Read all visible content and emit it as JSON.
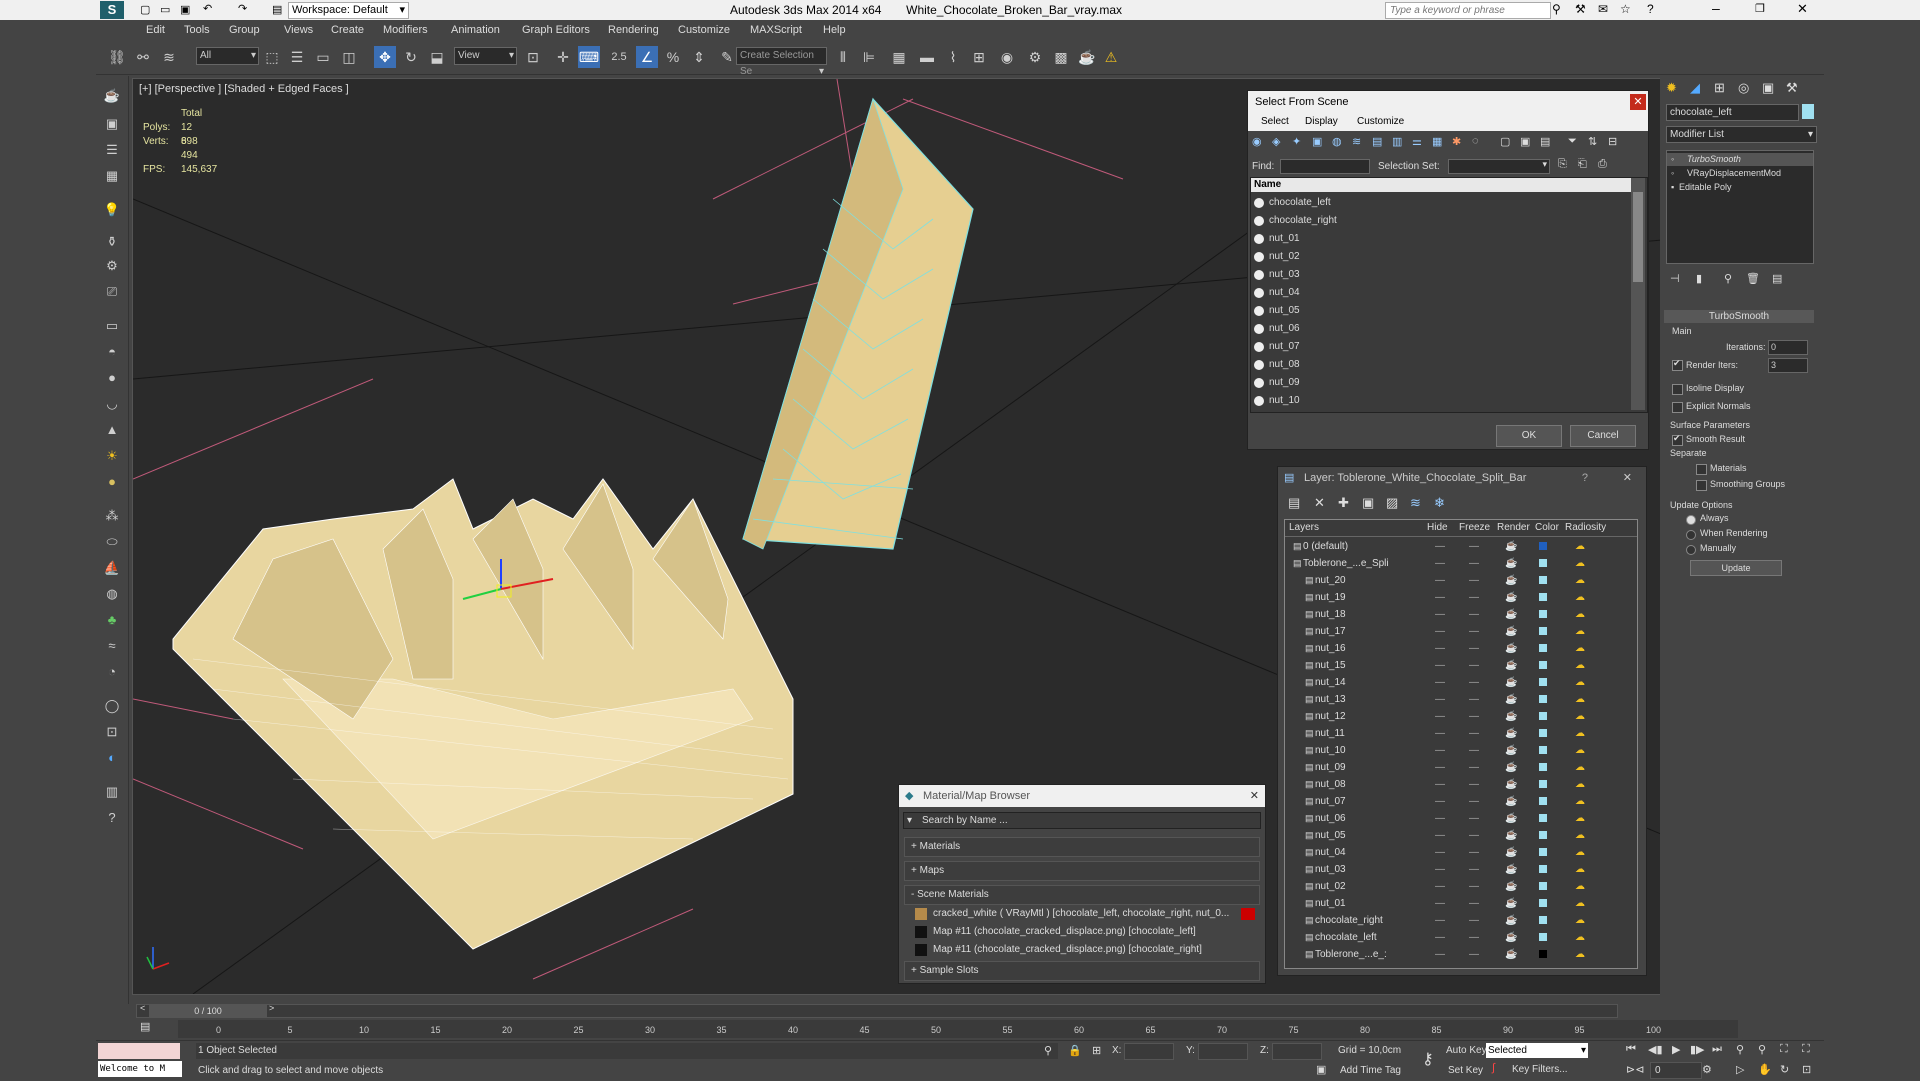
{
  "titlebar": {
    "app": "Autodesk 3ds Max  2014 x64",
    "file": "White_Chocolate_Broken_Bar_vray.max",
    "workspace": "Workspace: Default",
    "search_placeholder": "Type a keyword or phrase"
  },
  "menu": [
    "Edit",
    "Tools",
    "Group",
    "Views",
    "Create",
    "Modifiers",
    "Animation",
    "Graph Editors",
    "Rendering",
    "Customize",
    "MAXScript",
    "Help"
  ],
  "toolbar": {
    "selection_filter": "All",
    "ref_coord": "View",
    "create_selection_set": "Create Selection Se"
  },
  "viewport": {
    "label": "[+] [Perspective ] [Shaded + Edged Faces ]",
    "stats": {
      "total_label": "Total",
      "polys_label": "Polys:",
      "polys": "12 898",
      "verts_label": "Verts:",
      "verts": "6 494",
      "fps_label": "FPS:",
      "fps": "145,637"
    }
  },
  "select_from_scene": {
    "title": "Select From Scene",
    "menu": [
      "Select",
      "Display",
      "Customize"
    ],
    "find_label": "Find:",
    "selection_set_label": "Selection Set:",
    "column": "Name",
    "items": [
      "chocolate_left",
      "chocolate_right",
      "nut_01",
      "nut_02",
      "nut_03",
      "nut_04",
      "nut_05",
      "nut_06",
      "nut_07",
      "nut_08",
      "nut_09",
      "nut_10"
    ],
    "ok": "OK",
    "cancel": "Cancel"
  },
  "layer_dialog": {
    "title": "Layer: Toblerone_White_Chocolate_Split_Bar",
    "help": "?",
    "columns": [
      "Layers",
      "Hide",
      "Freeze",
      "Render",
      "Color",
      "Radiosity"
    ],
    "rows": [
      "0 (default)",
      "Toblerone_...e_Spli",
      "nut_20",
      "nut_19",
      "nut_18",
      "nut_17",
      "nut_16",
      "nut_15",
      "nut_14",
      "nut_13",
      "nut_12",
      "nut_11",
      "nut_10",
      "nut_09",
      "nut_08",
      "nut_07",
      "nut_06",
      "nut_05",
      "nut_04",
      "nut_03",
      "nut_02",
      "nut_01",
      "chocolate_right",
      "chocolate_left",
      "Toblerone_...e_:"
    ]
  },
  "material_browser": {
    "title": "Material/Map Browser",
    "search_placeholder": "Search by Name ...",
    "sections": [
      "+ Materials",
      "+ Maps",
      "- Scene Materials",
      "+ Sample Slots"
    ],
    "scene_materials": [
      "cracked_white  ( VRayMtl )  [chocolate_left, chocolate_right, nut_0...",
      "Map #11 (chocolate_cracked_displace.png) [chocolate_left]",
      "Map #11 (chocolate_cracked_displace.png) [chocolate_right]"
    ]
  },
  "command_panel": {
    "object_name": "chocolate_left",
    "modifier_list": "Modifier List",
    "stack": [
      "TurboSmooth",
      "VRayDisplacementMod",
      "Editable Poly"
    ],
    "rollout_title": "TurboSmooth",
    "main_label": "Main",
    "iterations_label": "Iterations:",
    "iterations": "0",
    "render_iters_label": "Render Iters:",
    "render_iters": "3",
    "isoline": "Isoline Display",
    "explicit_normals": "Explicit Normals",
    "surface_params": "Surface Parameters",
    "smooth_result": "Smooth Result",
    "separate": "Separate",
    "materials": "Materials",
    "smoothing_groups": "Smoothing Groups",
    "update_options": "Update Options",
    "always": "Always",
    "when_rendering": "When Rendering",
    "manually": "Manually",
    "update_btn": "Update"
  },
  "timeline": {
    "frame": "0 / 100",
    "ticks": [
      "0",
      "5",
      "10",
      "15",
      "20",
      "25",
      "30",
      "35",
      "40",
      "45",
      "50",
      "55",
      "60",
      "65",
      "70",
      "75",
      "80",
      "85",
      "90",
      "95",
      "100"
    ]
  },
  "status": {
    "maxscript": "Welcome to M",
    "selected": "1 Object Selected",
    "prompt": "Click and drag to select and move objects",
    "x_label": "X:",
    "y_label": "Y:",
    "z_label": "Z:",
    "grid": "Grid = 10,0cm",
    "auto_key": "Auto Key",
    "set_key": "Set Key",
    "key_mode": "Selected",
    "key_filters": "Key Filters...",
    "add_time_tag": "Add Time Tag",
    "current_frame": "0"
  }
}
